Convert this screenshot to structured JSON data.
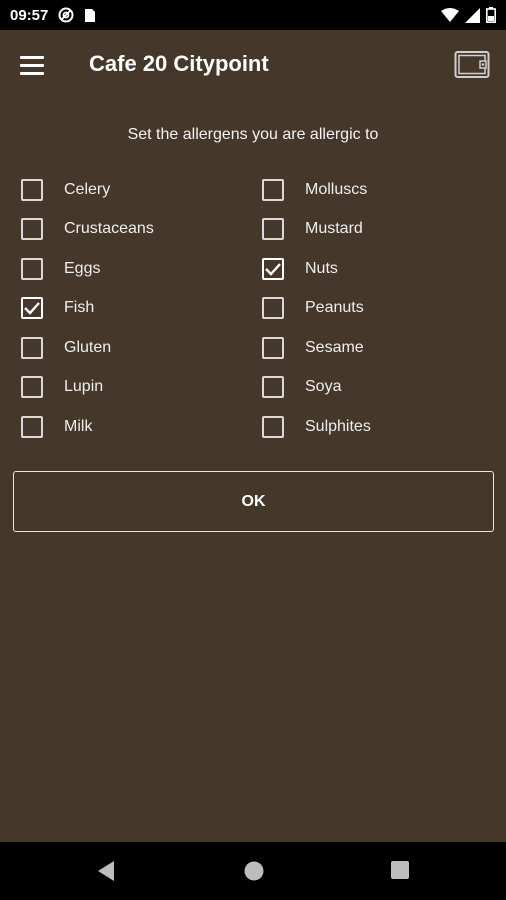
{
  "status_bar": {
    "time": "09:57",
    "left_icons": [
      "at-sign-icon",
      "sim-card-icon"
    ],
    "right_icons": [
      "wifi-icon",
      "signal-icon",
      "battery-icon"
    ]
  },
  "app_bar": {
    "title": "Cafe 20 Citypoint",
    "menu_icon": "hamburger-menu-icon",
    "action_icon": "wallet-icon"
  },
  "allergens": {
    "prompt": "Set the allergens you are allergic to",
    "left_column": [
      {
        "label": "Celery",
        "checked": false
      },
      {
        "label": "Crustaceans",
        "checked": false
      },
      {
        "label": "Eggs",
        "checked": false
      },
      {
        "label": "Fish",
        "checked": true
      },
      {
        "label": "Gluten",
        "checked": false
      },
      {
        "label": "Lupin",
        "checked": false
      },
      {
        "label": "Milk",
        "checked": false
      }
    ],
    "right_column": [
      {
        "label": "Molluscs",
        "checked": false
      },
      {
        "label": "Mustard",
        "checked": false
      },
      {
        "label": "Nuts",
        "checked": true
      },
      {
        "label": "Peanuts",
        "checked": false
      },
      {
        "label": "Sesame",
        "checked": false
      },
      {
        "label": "Soya",
        "checked": false
      },
      {
        "label": "Sulphites",
        "checked": false
      }
    ]
  },
  "ok_button": {
    "label": "OK"
  },
  "nav_bar": {
    "icons": [
      "back-icon",
      "home-icon",
      "recents-icon"
    ]
  },
  "colors": {
    "background": "#46372b",
    "status_bar": "#000000",
    "text": "#ffffff",
    "checkbox_border": "#d9d9d9"
  }
}
